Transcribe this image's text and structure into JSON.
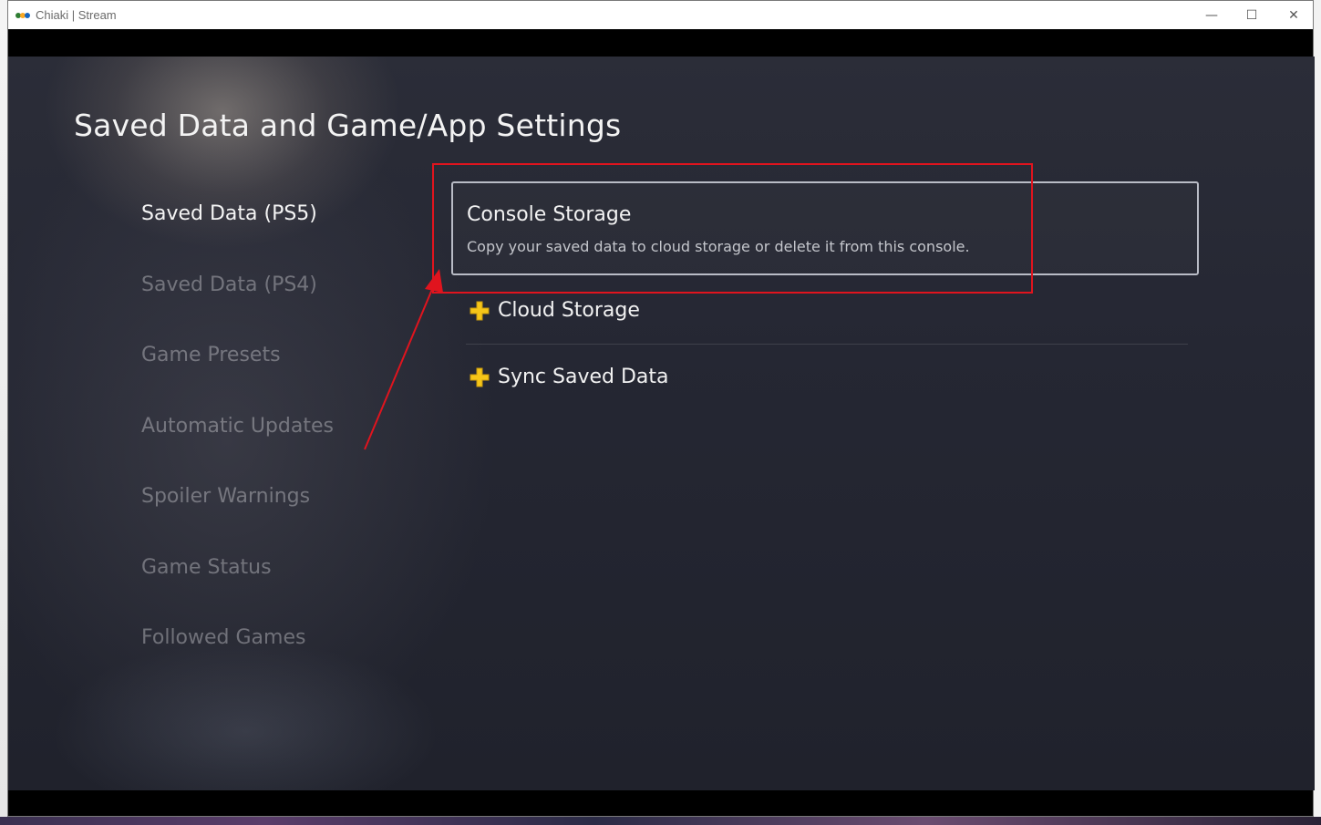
{
  "window": {
    "title": "Chiaki | Stream",
    "controls": {
      "minimize": "—",
      "maximize": "☐",
      "close": "✕"
    }
  },
  "stream": {
    "page_title": "Saved Data and Game/App Settings",
    "side_menu": [
      {
        "label": "Saved Data (PS5)",
        "active": true
      },
      {
        "label": "Saved Data (PS4)",
        "active": false
      },
      {
        "label": "Game Presets",
        "active": false
      },
      {
        "label": "Automatic Updates",
        "active": false
      },
      {
        "label": "Spoiler Warnings",
        "active": false
      },
      {
        "label": "Game Status",
        "active": false
      },
      {
        "label": "Followed Games",
        "active": false
      }
    ],
    "console_storage": {
      "title": "Console Storage",
      "description": "Copy your saved data to cloud storage or delete it from this console."
    },
    "options": [
      {
        "label": "Cloud Storage",
        "icon": "ps-plus-icon"
      },
      {
        "label": "Sync Saved Data",
        "icon": "ps-plus-icon"
      }
    ]
  },
  "colors": {
    "annotation": "#e0141e",
    "ps_plus_yellow": "#f5c518",
    "background": "#252733"
  }
}
